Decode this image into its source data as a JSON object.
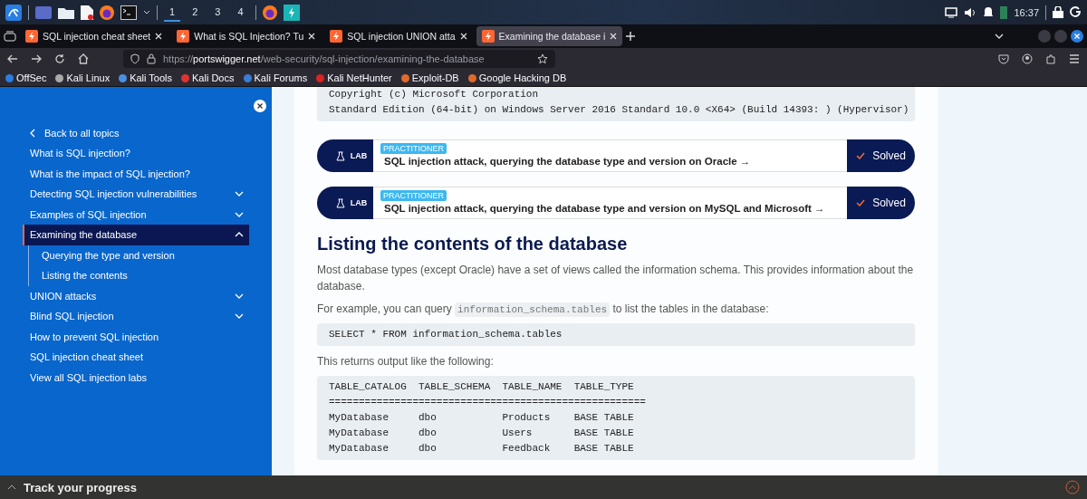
{
  "taskbar": {
    "workspaces": [
      {
        "label": "1",
        "selected": true
      },
      {
        "label": "2",
        "selected": false
      },
      {
        "label": "3",
        "selected": false
      },
      {
        "label": "4",
        "selected": false
      }
    ],
    "clock": "16:37"
  },
  "browser": {
    "tabs": [
      {
        "title": "SQL injection cheat sheet",
        "selected": false
      },
      {
        "title": "What is SQL Injection? Tu",
        "selected": false
      },
      {
        "title": "SQL injection UNION atta",
        "selected": false
      },
      {
        "title": "Examining the database i",
        "selected": true
      }
    ],
    "url": {
      "scheme": "https://",
      "host": "portswigger.net",
      "path": "/web-security/sql-injection/examining-the-database"
    },
    "bookmarks": [
      "OffSec",
      "Kali Linux",
      "Kali Tools",
      "Kali Docs",
      "Kali Forums",
      "Kali NetHunter",
      "Exploit-DB",
      "Google Hacking DB"
    ]
  },
  "sidebar": {
    "back": "Back to all topics",
    "items": [
      {
        "label": "What is SQL injection?",
        "selected": false
      },
      {
        "label": "What is the impact of SQL injection?",
        "selected": false
      },
      {
        "label": "Detecting SQL injection vulnerabilities",
        "selected": false,
        "expanded": false
      },
      {
        "label": "Examples of SQL injection",
        "selected": false,
        "expanded": false
      },
      {
        "label": "Examining the database",
        "selected": true,
        "expanded": true,
        "children": [
          {
            "label": "Querying the type and version",
            "selected": false
          },
          {
            "label": "Listing the contents",
            "selected": false
          }
        ]
      },
      {
        "label": "UNION attacks",
        "selected": false,
        "expanded": false
      },
      {
        "label": "Blind SQL injection",
        "selected": false,
        "expanded": false
      },
      {
        "label": "How to prevent SQL injection",
        "selected": false
      },
      {
        "label": "SQL injection cheat sheet",
        "selected": false
      },
      {
        "label": "View all SQL injection labs",
        "selected": false
      }
    ]
  },
  "article": {
    "blocks": [
      {
        "kind": "code",
        "text": "Copyright (c) Microsoft Corporation\nStandard Edition (64-bit) on Windows Server 2016 Standard 10.0 <X64> (Build 14393: ) (Hypervisor)"
      },
      {
        "kind": "lab",
        "badge": "LAB",
        "level": "PRACTITIONER",
        "title": "SQL injection attack, querying the database type and version on Oracle →",
        "status": "Solved"
      },
      {
        "kind": "lab",
        "badge": "LAB",
        "level": "PRACTITIONER",
        "title": "SQL injection attack, querying the database type and version on MySQL and Microsoft →",
        "status": "Solved"
      },
      {
        "kind": "heading",
        "text": "Listing the contents of the database"
      },
      {
        "kind": "paragraph",
        "text": "Most database types (except Oracle) have a set of views called the information schema. This provides information about the database."
      },
      {
        "kind": "paragraph",
        "text": "For example, you can query ",
        "code": "information_schema.tables",
        "after": " to list the tables in the database:"
      },
      {
        "kind": "code",
        "text": "SELECT * FROM information_schema.tables"
      },
      {
        "kind": "paragraph",
        "text": "This returns output like the following:"
      },
      {
        "kind": "code",
        "text": "TABLE_CATALOG  TABLE_SCHEMA  TABLE_NAME  TABLE_TYPE\n=====================================================\nMyDatabase     dbo           Products    BASE TABLE\nMyDatabase     dbo           Users       BASE TABLE\nMyDatabase     dbo           Feedback    BASE TABLE"
      }
    ]
  },
  "progress_bar": {
    "label": "Track your progress",
    "expanded": false
  }
}
